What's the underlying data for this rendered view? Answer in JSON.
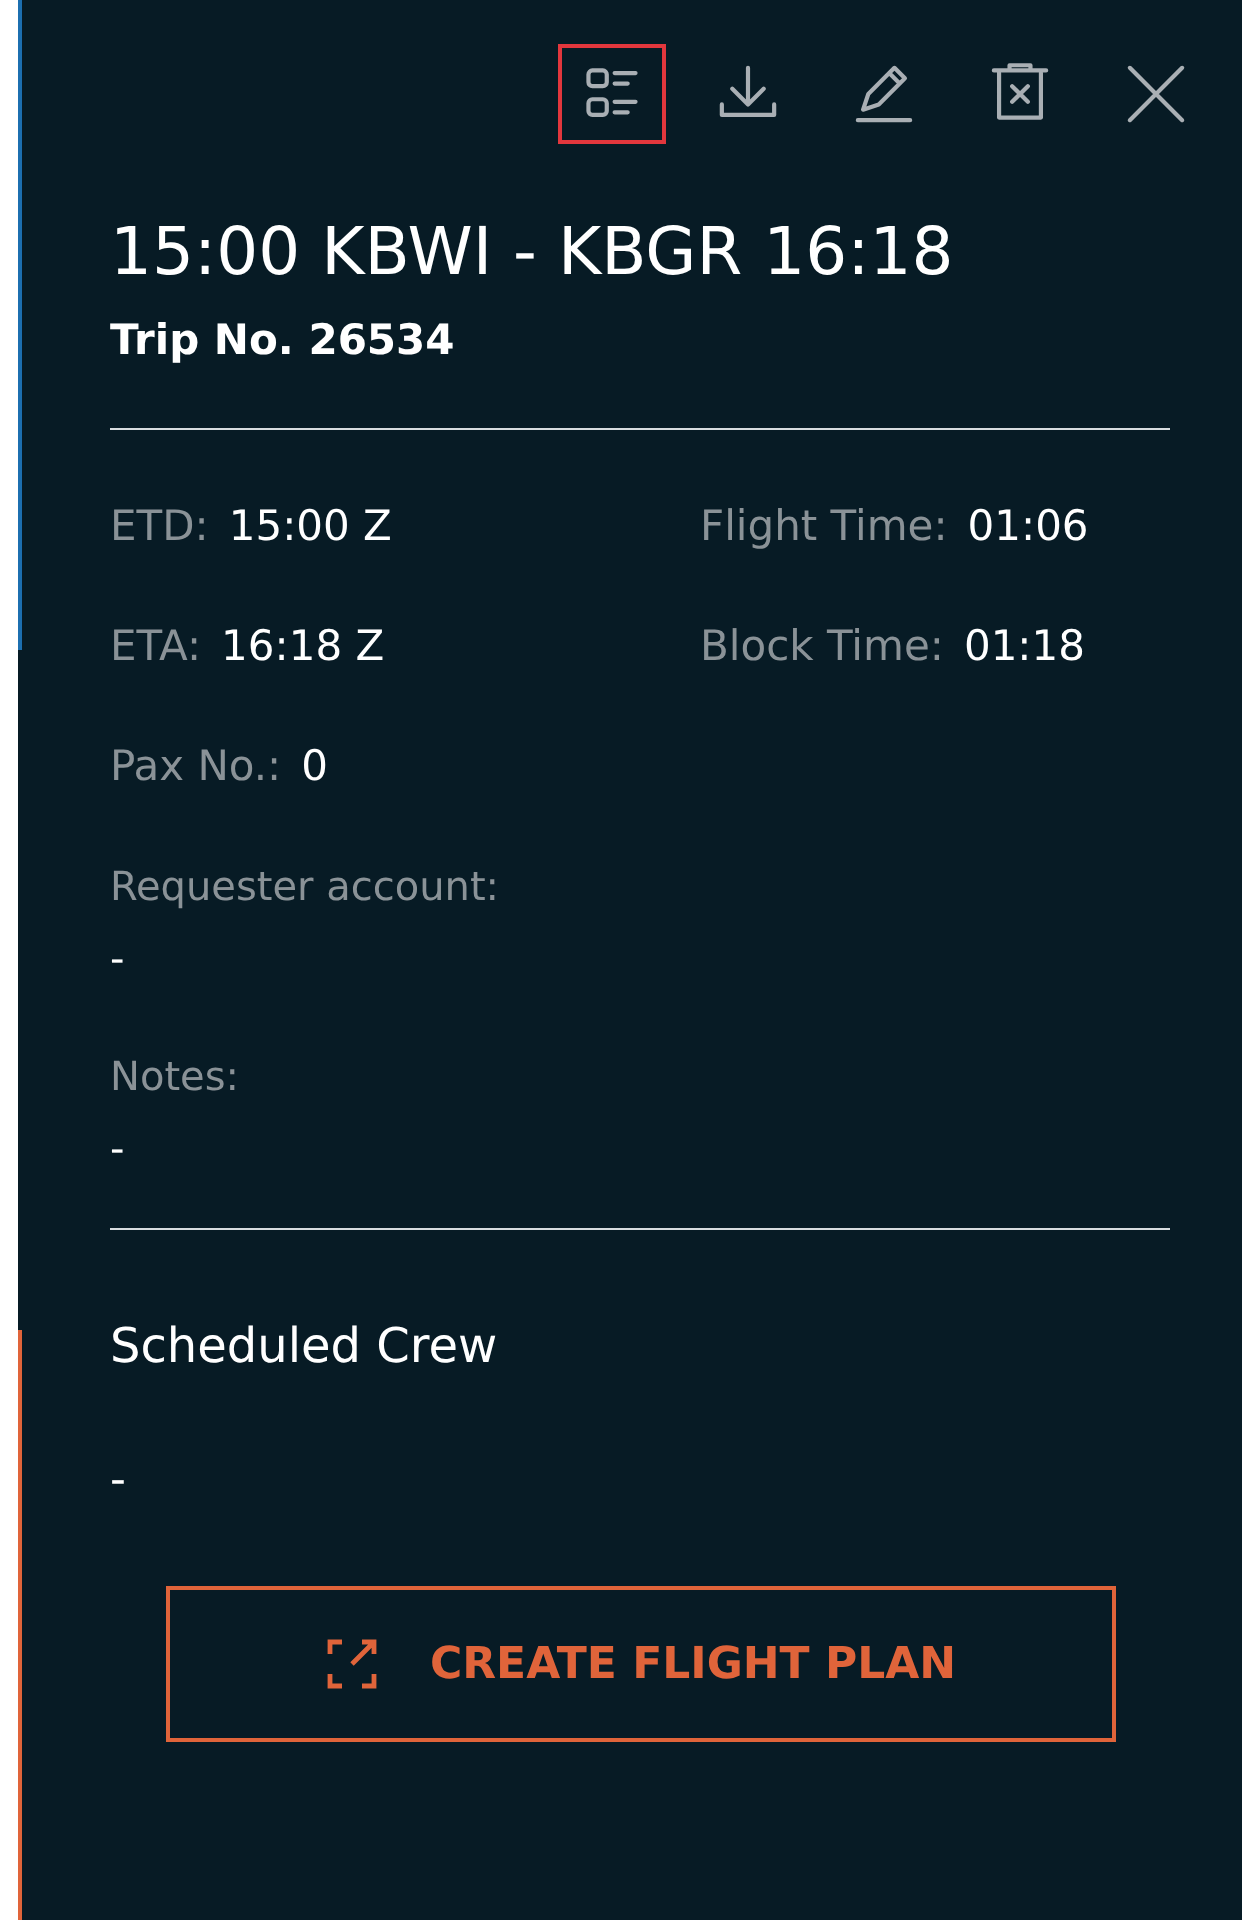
{
  "toolbar": [
    {
      "kind": "details",
      "selected": true
    },
    {
      "kind": "download",
      "selected": false
    },
    {
      "kind": "edit",
      "selected": false
    },
    {
      "kind": "delete",
      "selected": false
    },
    {
      "kind": "close",
      "selected": false
    }
  ],
  "title": "15:00 KBWI - KBGR 16:18",
  "trip_number": "Trip No. 26534",
  "times": [
    {
      "label": "ETD:",
      "value": "15:00 Z"
    },
    {
      "label": "Flight Time:",
      "value": "01:06"
    },
    {
      "label": "ETA:",
      "value": "16:18 Z"
    },
    {
      "label": "Block Time:",
      "value": "01:18"
    },
    {
      "label": "Pax No.:",
      "value": "0"
    }
  ],
  "details": [
    {
      "label": "Requester account:",
      "value": "-"
    },
    {
      "label": "Notes:",
      "value": "-"
    }
  ],
  "crew": {
    "heading": "Scheduled Crew",
    "value": "-"
  },
  "action_button": {
    "label": "CREATE FLIGHT PLAN"
  }
}
